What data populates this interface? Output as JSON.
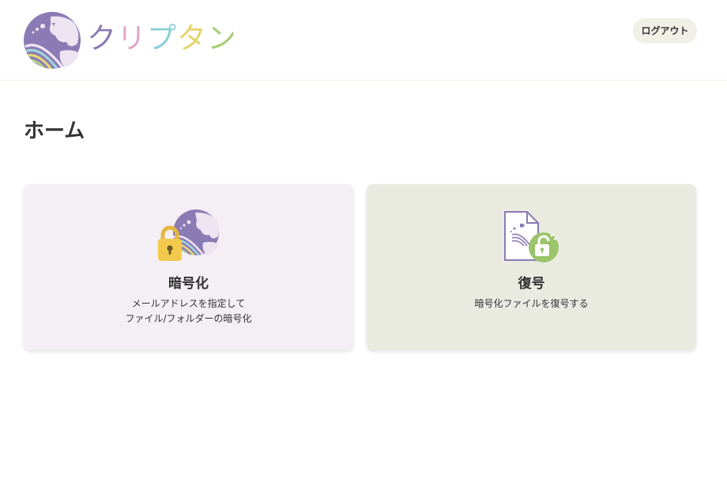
{
  "header": {
    "brand_chars": [
      "ク",
      "リ",
      "プ",
      "タ",
      "ン"
    ],
    "logout_label": "ログアウト"
  },
  "page": {
    "title": "ホーム"
  },
  "cards": {
    "encrypt": {
      "title": "暗号化",
      "desc_line1": "メールアドレスを指定して",
      "desc_line2": "ファイル/フォルダーの暗号化",
      "icon": "lock-globe-icon"
    },
    "decrypt": {
      "title": "復号",
      "desc_line1": "暗号化ファイルを復号する",
      "icon": "file-unlock-icon"
    }
  },
  "colors": {
    "logo_purple": "#8b7bb5",
    "brand_ku": "#8b7bb5",
    "brand_ri": "#e0a7c8",
    "brand_pu": "#8ccfd7",
    "brand_ta": "#e6d570",
    "brand_n": "#a9cd7a",
    "logout_bg": "#f1f0e6",
    "encrypt_card_bg": "#f4eef5",
    "decrypt_card_bg": "#e9ebe1",
    "lock_yellow": "#f2c94c",
    "unlock_green": "#9cc46a"
  }
}
